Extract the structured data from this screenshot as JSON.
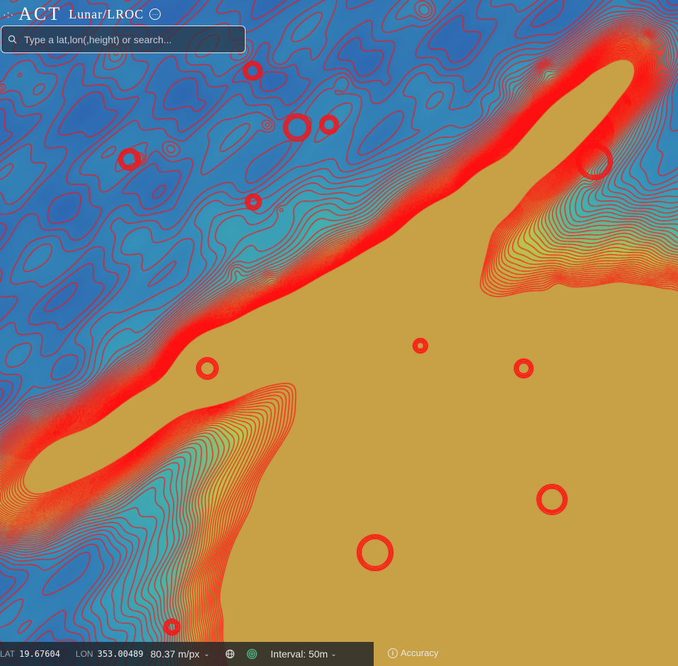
{
  "header": {
    "logo": "ACT",
    "mission": "Lunar/LROC",
    "menu_icon": "more-options-icon"
  },
  "search": {
    "placeholder": "Type a lat,lon(,height) or search...",
    "icon": "search-icon"
  },
  "status": {
    "lat_label": "LAT",
    "lat_value": "19.67604",
    "lon_label": "LON",
    "lon_value": "353.00489",
    "resolution": "80.37 m/px",
    "interval": "Interval: 50m",
    "accuracy": "Accuracy",
    "globe_icon": "globe-icon",
    "contour_icon": "contour-icon"
  },
  "colors": {
    "contour": "#ff1010",
    "low_terrain": "#2f6db3",
    "mid_terrain": "#39a6b8",
    "high_terrain": "#cfd24a"
  }
}
